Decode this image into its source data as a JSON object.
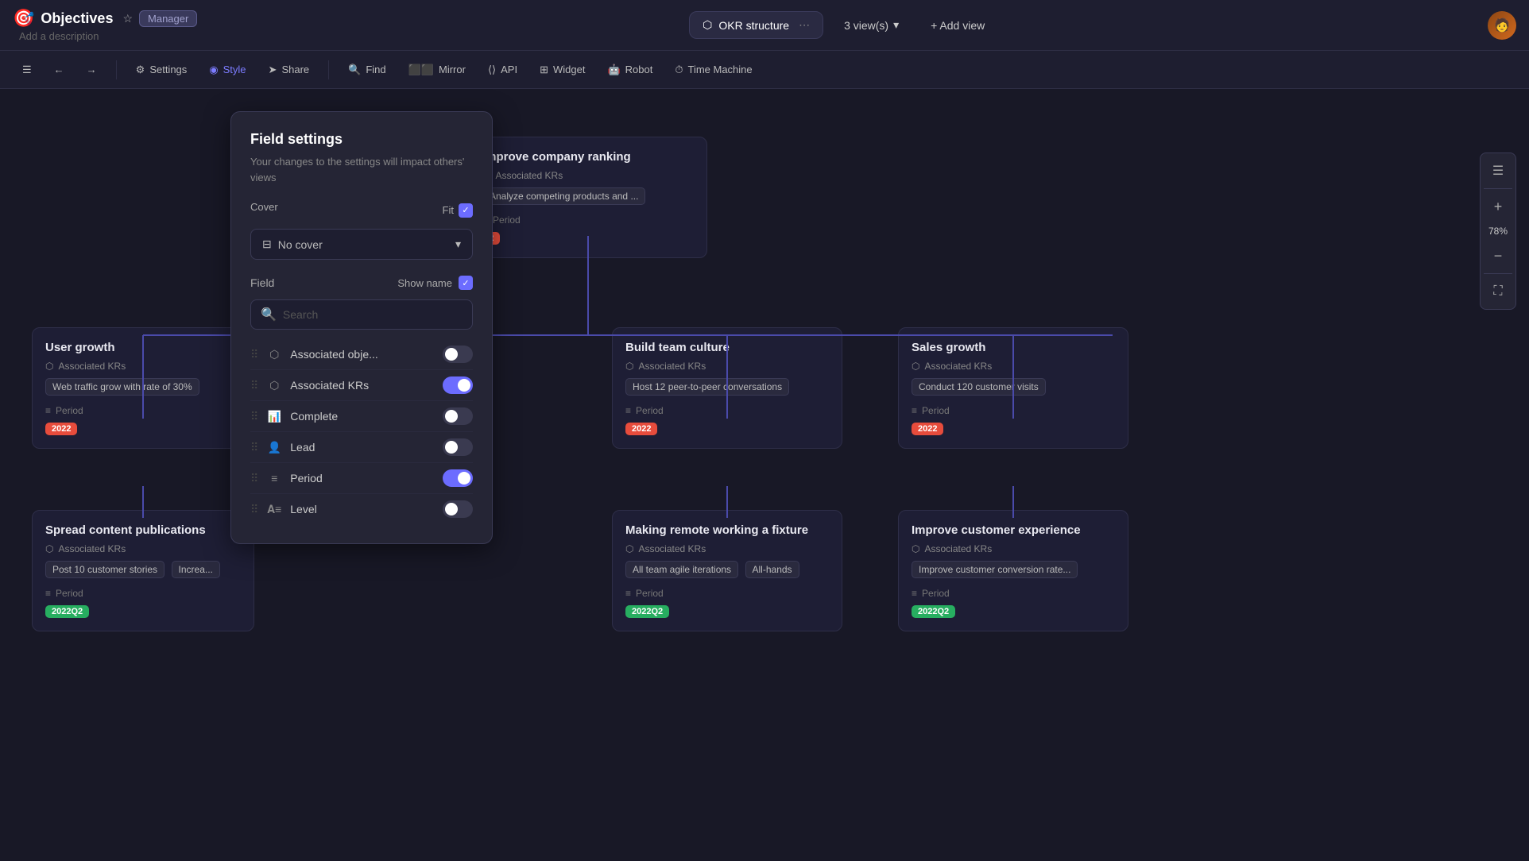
{
  "app": {
    "icon": "🎯",
    "title": "Objectives",
    "manager_label": "Manager",
    "add_description": "Add a description"
  },
  "tabs": {
    "active_tab": "OKR structure",
    "dot_menu": "⋯",
    "views_count": "3 view(s)",
    "add_view": "+ Add view"
  },
  "toolbar": {
    "settings": "Settings",
    "style": "Style",
    "share": "Share",
    "find": "Find",
    "mirror": "Mirror",
    "api": "API",
    "widget": "Widget",
    "robot": "Robot",
    "time_machine": "Time Machine"
  },
  "field_settings": {
    "title": "Field settings",
    "subtitle": "Your changes to the settings\nwill impact others' views",
    "cover_label": "Cover",
    "fit_label": "Fit",
    "no_cover": "No cover",
    "field_label": "Field",
    "show_name_label": "Show name",
    "search_placeholder": "Search",
    "fields": [
      {
        "name": "Associated obje...",
        "icon": "🔗",
        "enabled": false
      },
      {
        "name": "Associated KRs",
        "icon": "🔗",
        "enabled": true
      },
      {
        "name": "Complete",
        "icon": "📊",
        "enabled": false
      },
      {
        "name": "Lead",
        "icon": "👤",
        "enabled": false
      },
      {
        "name": "Period",
        "icon": "≡",
        "enabled": true
      },
      {
        "name": "Level",
        "icon": "𝐀≡",
        "enabled": false
      }
    ]
  },
  "cards": {
    "improve_company": {
      "title": "Improve company ranking",
      "kr_label": "Associated KRs",
      "tag1": "Analyze competing products and ...",
      "period_label": "Period"
    },
    "user_growth": {
      "title": "User growth",
      "kr_label": "Associated KRs",
      "tag1": "Web traffic grow with rate of 30%",
      "period_label": "Period",
      "badge": "2022",
      "badge_type": "red"
    },
    "spread_content": {
      "title": "Spread content publications",
      "kr_label": "Associated KRs",
      "tag1": "Post 10 customer stories",
      "tag2": "Increa...",
      "period_label": "Period",
      "badge": "2022Q2",
      "badge_type": "green"
    },
    "build_team": {
      "title": "Build team culture",
      "kr_label": "Associated KRs",
      "tag1": "Host 12 peer-to-peer conversations",
      "period_label": "Period",
      "badge": "2022",
      "badge_type": "red"
    },
    "making_remote": {
      "title": "Making remote working a fixture",
      "kr_label": "Associated KRs",
      "tag1": "All team agile iterations",
      "tag2": "All-hands",
      "period_label": "Period",
      "badge": "2022Q2",
      "badge_type": "green"
    },
    "sales_growth": {
      "title": "Sales growth",
      "kr_label": "Associated KRs",
      "tag1": "Conduct 120 customer visits",
      "period_label": "Period",
      "badge": "2022",
      "badge_type": "red"
    },
    "improve_customer": {
      "title": "Improve customer experience",
      "kr_label": "Associated KRs",
      "tag1": "Improve customer conversion rate...",
      "period_label": "Period",
      "badge": "2022Q2",
      "badge_type": "green"
    }
  },
  "zoom": {
    "value": "78%",
    "plus": "+",
    "minus": "−"
  }
}
